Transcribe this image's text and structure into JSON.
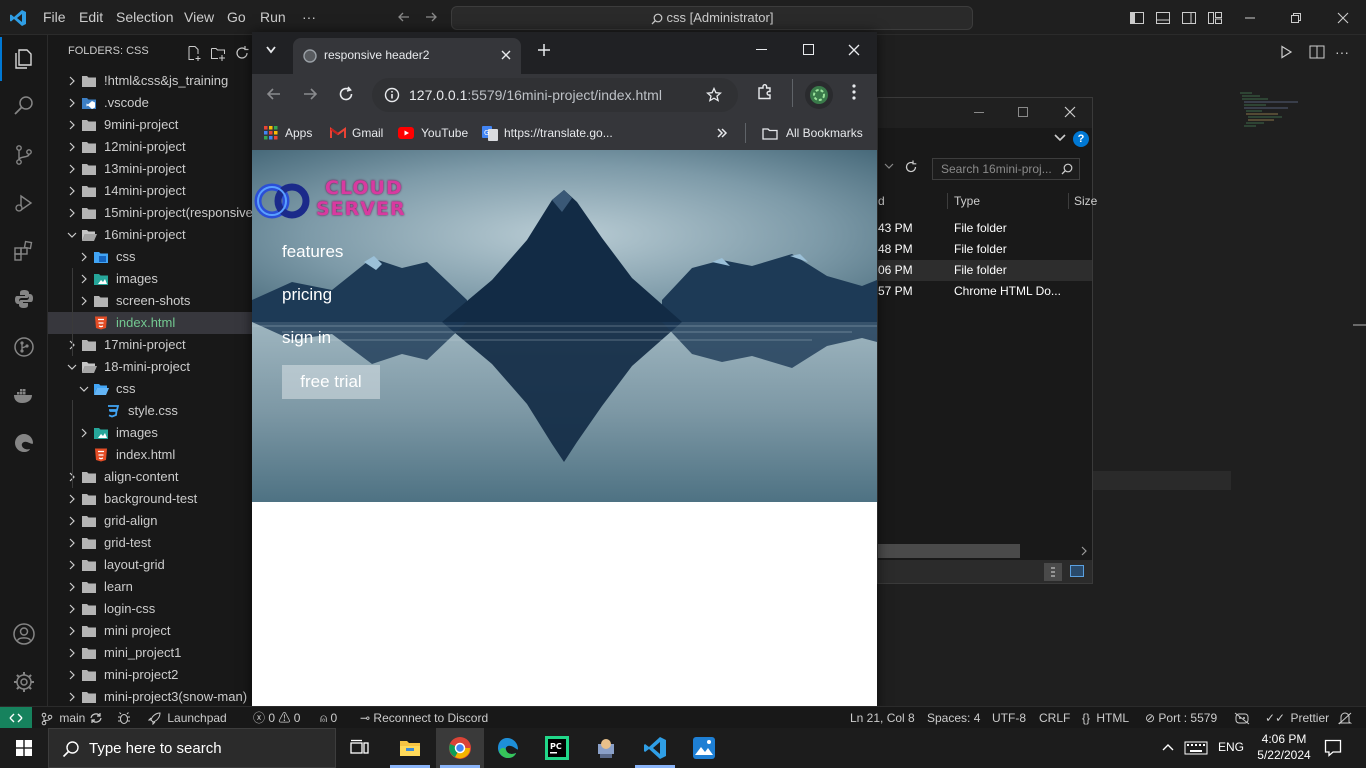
{
  "titlebar": {
    "menu": [
      "File",
      "Edit",
      "Selection",
      "View",
      "Go",
      "Run",
      "···"
    ],
    "command_center": "css [Administrator]"
  },
  "sidebar": {
    "header": "FOLDERS: CSS",
    "items": [
      {
        "label": "!html&css&js_training",
        "type": "folder"
      },
      {
        "label": ".vscode",
        "type": "vscode"
      },
      {
        "label": "9mini-project",
        "type": "folder"
      },
      {
        "label": "12mini-project",
        "type": "folder"
      },
      {
        "label": "13mini-project",
        "type": "folder"
      },
      {
        "label": "14mini-project",
        "type": "folder"
      },
      {
        "label": "15mini-project(responsive",
        "type": "folder"
      },
      {
        "label": "16mini-project",
        "type": "folder-open"
      },
      {
        "label": "css",
        "type": "css-folder"
      },
      {
        "label": "images",
        "type": "img-folder"
      },
      {
        "label": "screen-shots",
        "type": "folder"
      },
      {
        "label": "index.html",
        "type": "html"
      },
      {
        "label": "17mini-project",
        "type": "folder"
      },
      {
        "label": "18-mini-project",
        "type": "folder-open"
      },
      {
        "label": "css",
        "type": "css-folder-open"
      },
      {
        "label": "style.css",
        "type": "css"
      },
      {
        "label": "images",
        "type": "img-folder"
      },
      {
        "label": "index.html",
        "type": "html"
      },
      {
        "label": "align-content",
        "type": "folder"
      },
      {
        "label": "background-test",
        "type": "folder"
      },
      {
        "label": "grid-align",
        "type": "folder"
      },
      {
        "label": "grid-test",
        "type": "folder"
      },
      {
        "label": "layout-grid",
        "type": "folder"
      },
      {
        "label": "learn",
        "type": "folder"
      },
      {
        "label": "login-css",
        "type": "folder"
      },
      {
        "label": "mini project",
        "type": "folder"
      },
      {
        "label": "mini_project1",
        "type": "folder"
      },
      {
        "label": "mini-project2",
        "type": "folder"
      },
      {
        "label": "mini-project3(snow-man)",
        "type": "folder"
      }
    ]
  },
  "chrome": {
    "tab_title": "responsive header2",
    "url_host": "127.0.0.1",
    "url_rest": ":5579/16mini-project/index.html",
    "bookmarks": [
      "Apps",
      "Gmail",
      "YouTube",
      "https://translate.go..."
    ],
    "all_bookmarks": "All Bookmarks",
    "page": {
      "logo_line1": "CLOUD",
      "logo_line2": "SERVER",
      "nav": [
        "features",
        "pricing",
        "sign in"
      ],
      "cta": "free trial"
    }
  },
  "explorer": {
    "search_placeholder": "Search 16mini-proj...",
    "col_date": "d",
    "col_type": "Type",
    "col_size": "Size",
    "rows": [
      {
        "time": "43 PM",
        "type": "File folder"
      },
      {
        "time": "48 PM",
        "type": "File folder"
      },
      {
        "time": "06 PM",
        "type": "File folder"
      },
      {
        "time": "57 PM",
        "type": "Chrome HTML Do..."
      }
    ]
  },
  "statusbar": {
    "branch": "main",
    "launchpad": "Launchpad",
    "problems": "0 ⚠ 0",
    "ports": "0",
    "discord": "Reconnect to Discord",
    "position": "Ln 21, Col 8",
    "spaces": "Spaces: 4",
    "encoding": "UTF-8",
    "eol": "CRLF",
    "language": "HTML",
    "port": "Port : 5579",
    "prettier": "Prettier"
  },
  "taskbar": {
    "search_placeholder": "Type here to search",
    "lang": "ENG",
    "time": "4:06 PM",
    "date": "5/22/2024"
  },
  "colors": {
    "accent": "#0078d4",
    "remote": "#16825d",
    "pink_logo": "#e040a0",
    "html_orange": "#e44d26",
    "css_blue": "#42a5f5",
    "green_active": "#73c991"
  }
}
